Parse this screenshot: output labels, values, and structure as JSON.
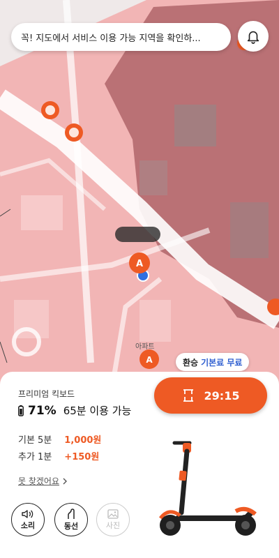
{
  "banner": {
    "text": "꼭! 지도에서 서비스 이용 가능 지역을 확인하..."
  },
  "map": {
    "building_label": "아파트",
    "tooltip_text": "",
    "colors": {
      "zone": "#f2b5b5",
      "restricted": "#b66d72",
      "road": "#ffffff",
      "accent": "#ee5a24",
      "location": "#2f6fe0"
    }
  },
  "transfer_chip": {
    "label": "환승",
    "value": "기본료 무료"
  },
  "vehicle": {
    "model": "프리미엄 킥보드",
    "battery_percent": "71%",
    "battery_text": "65분 이용 가능"
  },
  "pricing": [
    {
      "label": "기본 5분",
      "value": "1,000원"
    },
    {
      "label": "추가 1분",
      "value": "+150원"
    }
  ],
  "lost_link": "못 찾겠어요",
  "actions": [
    {
      "label": "소리",
      "icon": "speaker-icon",
      "enabled": true
    },
    {
      "label": "동선",
      "icon": "route-icon",
      "enabled": true
    },
    {
      "label": "사진",
      "icon": "photo-icon",
      "enabled": false
    }
  ],
  "timer": {
    "time": "29:15",
    "icon": "timer-icon"
  }
}
